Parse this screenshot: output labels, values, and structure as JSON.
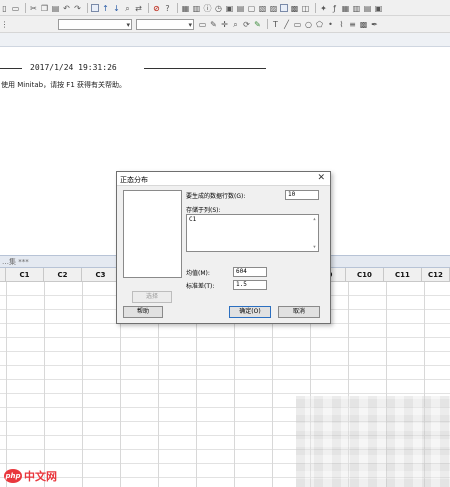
{
  "session": {
    "date_line": "2017/1/24 19:31:26",
    "welcome_text": "使用 Minitab，请按 F1 获得有关帮助。"
  },
  "worksheet": {
    "title": "…集 ***",
    "columns": [
      "C1",
      "C2",
      "C3",
      "C4",
      "C5",
      "C6",
      "C7",
      "C8",
      "C9",
      "C10",
      "C11",
      "C12"
    ]
  },
  "dialog": {
    "title": "正态分布",
    "rows_label": "要生成的数据行数(G):",
    "rows_value": "10",
    "store_label": "存储于列(S):",
    "store_value": "C1",
    "mean_label": "均值(M):",
    "mean_value": "604",
    "sd_label": "标准差(T):",
    "sd_value": "1.5",
    "select_button": "选择",
    "help_button": "帮助",
    "ok_button": "确定(O)",
    "cancel_button": "取消",
    "close_symbol": "✕"
  },
  "watermark": {
    "badge": "php",
    "text": "中文网"
  }
}
